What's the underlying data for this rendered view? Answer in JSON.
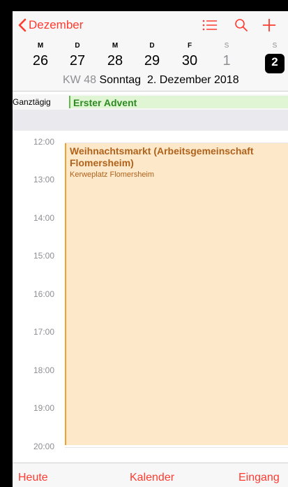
{
  "header": {
    "back_label": "Dezember",
    "list_icon": "list-icon",
    "search_icon": "search-icon",
    "add_icon": "plus-icon"
  },
  "week": {
    "day_letters": [
      "M",
      "D",
      "M",
      "D",
      "F",
      "S",
      "S"
    ],
    "day_numbers": [
      "26",
      "27",
      "28",
      "29",
      "30",
      "1",
      "2"
    ],
    "kw_label": "KW 48",
    "date_label": "Sonntag  2. Dezember 2018"
  },
  "allday": {
    "label": "Ganztägig",
    "event_title": "Erster Advent"
  },
  "hours": [
    "12:00",
    "13:00",
    "14:00",
    "15:00",
    "16:00",
    "17:00",
    "18:00",
    "19:00",
    "20:00"
  ],
  "event": {
    "title": "Weihnachtsmarkt (Arbeitsgemeinschaft Flomersheim)",
    "location": "Kerweplatz Flomersheim"
  },
  "tabbar": {
    "today": "Heute",
    "calendars": "Kalender",
    "inbox": "Eingang"
  },
  "colors": {
    "accent": "#ff3b30",
    "allday_event_bg": "#dff5d4",
    "allday_event_text": "#2e8b22",
    "event_bg": "#fde8c9",
    "event_text": "#b0621b"
  }
}
